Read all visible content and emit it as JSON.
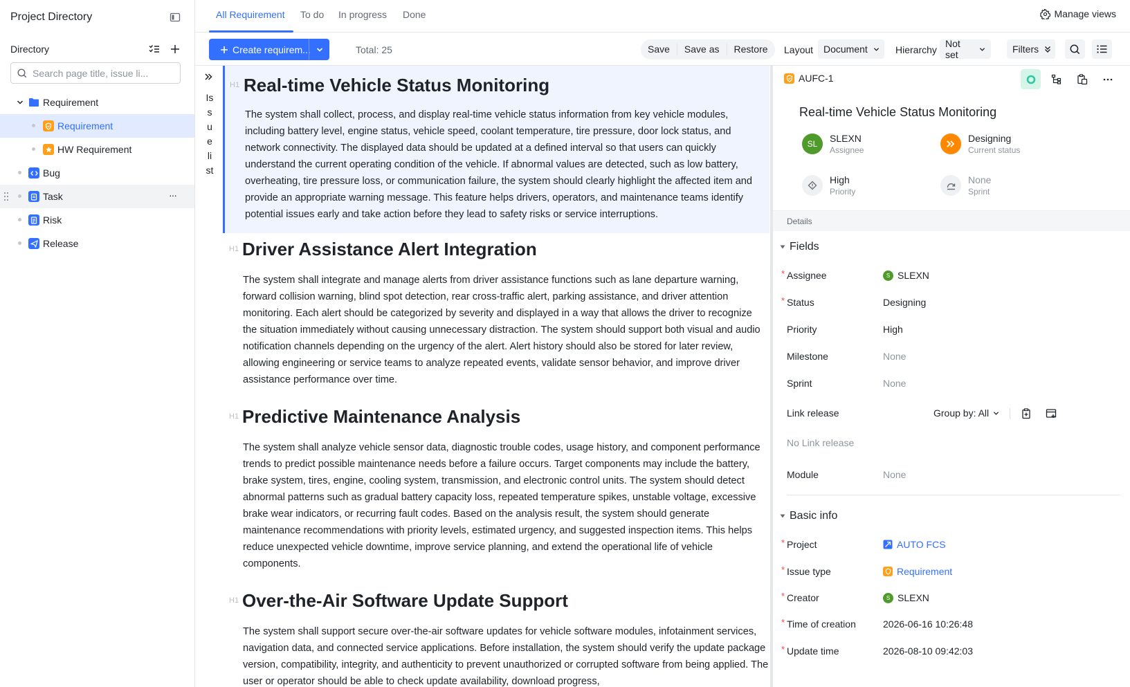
{
  "sidebar": {
    "title": "Project Directory",
    "directory_label": "Directory",
    "search_placeholder": "Search page title, issue li...",
    "items": [
      {
        "label": "Requirement"
      },
      {
        "label": "Requirement"
      },
      {
        "label": "HW Requirement"
      },
      {
        "label": "Bug"
      },
      {
        "label": "Task",
        "more": "···"
      },
      {
        "label": "Risk"
      },
      {
        "label": "Release"
      }
    ]
  },
  "tabs": [
    {
      "label": "All Requirement"
    },
    {
      "label": "To do"
    },
    {
      "label": "In progress"
    },
    {
      "label": "Done"
    }
  ],
  "manage_views": "Manage views",
  "toolbar": {
    "create_label": "Create requirem...",
    "total": "Total: 25",
    "save": "Save",
    "save_as": "Save as",
    "restore": "Restore",
    "layout_label": "Layout",
    "layout_value": "Document",
    "hierarchy_label": "Hierarchy",
    "hierarchy_value": "Not set",
    "filters": "Filters"
  },
  "toc_label": "Issue list",
  "toc_chars": [
    "Is",
    "s",
    "u",
    "e",
    "li",
    "st"
  ],
  "h1_tag": "H1",
  "doc": {
    "sections": [
      {
        "title": "Real-time Vehicle Status Monitoring",
        "body": "The system shall collect, process, and display real-time vehicle status information from key vehicle modules, including battery level, engine status, vehicle speed, coolant temperature, tire pressure, door lock status, and network connectivity. The displayed data should be updated at a defined interval so that users can quickly understand the current operating condition of the vehicle. If abnormal values are detected, such as low battery, overheating, tire pressure loss, or communication failure, the system should clearly highlight the affected item and provide an appropriate warning message. This feature helps drivers, operators, and maintenance teams identify potential issues early and take action before they lead to safety risks or service interruptions."
      },
      {
        "title": "Driver Assistance Alert Integration",
        "body": "The system shall integrate and manage alerts from driver assistance functions such as lane departure warning, forward collision warning, blind spot detection, rear cross-traffic alert, parking assistance, and driver attention monitoring. Each alert should be categorized by severity and displayed in a way that allows the driver to recognize the situation immediately without causing unnecessary distraction. The system should support both visual and audio notification channels depending on the urgency of the alert. Alert history should also be stored for later review, allowing engineering or service teams to analyze repeated events, validate sensor behavior, and improve driver assistance performance over time."
      },
      {
        "title": "Predictive Maintenance Analysis",
        "body": "The system shall analyze vehicle sensor data, diagnostic trouble codes, usage history, and component performance trends to predict possible maintenance needs before a failure occurs. Target components may include the battery, brake system, tires, engine, cooling system, transmission, and electronic control units. The system should detect abnormal patterns such as gradual battery capacity loss, repeated temperature spikes, unstable voltage, excessive brake wear indicators, or recurring fault codes. Based on the analysis result, the system should generate maintenance recommendations with priority levels, estimated urgency, and suggested inspection items. This helps reduce unexpected vehicle downtime, improve service planning, and extend the operational life of vehicle components."
      },
      {
        "title": "Over-the-Air Software Update Support",
        "body": "The system shall support secure over-the-air software updates for vehicle software modules, infotainment services, navigation data, and connected service applications. Before installation, the system should verify the update package version, compatibility, integrity, and authenticity to prevent unauthorized or corrupted software from being applied. The user or operator should be able to check update availability, download progress,"
      }
    ]
  },
  "detail": {
    "issue_key": "AUFC-1",
    "title": "Real-time Vehicle Status Monitoring",
    "summary": {
      "assignee": {
        "initials": "SL",
        "value": "SLEXN",
        "sub": "Assignee"
      },
      "status": {
        "value": "Designing",
        "sub": "Current status"
      },
      "priority": {
        "value": "High",
        "sub": "Priority"
      },
      "sprint": {
        "value": "None",
        "sub": "Sprint"
      }
    },
    "details_label": "Details",
    "fields_label": "Fields",
    "fields": {
      "assignee": {
        "label": "Assignee",
        "initial": "S",
        "value": "SLEXN"
      },
      "status": {
        "label": "Status",
        "value": "Designing"
      },
      "priority": {
        "label": "Priority",
        "value": "High"
      },
      "milestone": {
        "label": "Milestone",
        "value": "None"
      },
      "sprint": {
        "label": "Sprint",
        "value": "None"
      },
      "link_release": {
        "label": "Link release",
        "group_by": "Group by: All",
        "empty": "No Link release"
      },
      "module": {
        "label": "Module",
        "value": "None"
      }
    },
    "basic_label": "Basic info",
    "basic": {
      "project": {
        "label": "Project",
        "value": "AUTO FCS"
      },
      "issue_type": {
        "label": "Issue type",
        "value": "Requirement"
      },
      "creator": {
        "label": "Creator",
        "initial": "S",
        "value": "SLEXN"
      },
      "time_created": {
        "label": "Time of creation",
        "value": "2026-06-16 10:26:48"
      },
      "update_time": {
        "label": "Update time",
        "value": "2026-08-10 09:42:03"
      }
    },
    "required_mark": "*"
  },
  "colors": {
    "accent": "#3370ff",
    "status_orange": "#ff8800",
    "avatar_green": "#4e9a2a",
    "requirement_orange": "#ff9f1a",
    "bug_blue": "#3370ff"
  }
}
